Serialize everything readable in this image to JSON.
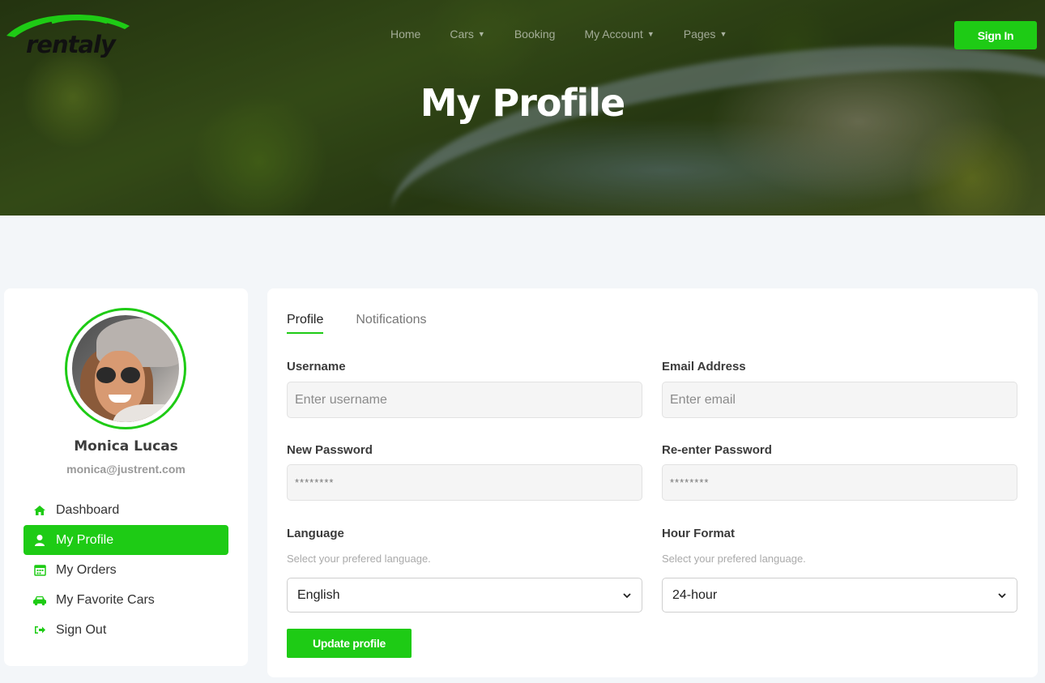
{
  "brand": {
    "logo_text": "rentaly"
  },
  "nav": {
    "items": [
      {
        "label": "Home",
        "has_dropdown": false
      },
      {
        "label": "Cars",
        "has_dropdown": true
      },
      {
        "label": "Booking",
        "has_dropdown": false
      },
      {
        "label": "My Account",
        "has_dropdown": true
      },
      {
        "label": "Pages",
        "has_dropdown": true
      }
    ],
    "signin_label": "Sign In"
  },
  "hero": {
    "title": "My Profile"
  },
  "sidebar": {
    "user_name": "Monica Lucas",
    "user_email": "monica@justrent.com",
    "menu": [
      {
        "label": "Dashboard",
        "icon": "home-icon",
        "active": false
      },
      {
        "label": "My Profile",
        "icon": "user-icon",
        "active": true
      },
      {
        "label": "My Orders",
        "icon": "calendar-icon",
        "active": false
      },
      {
        "label": "My Favorite Cars",
        "icon": "car-icon",
        "active": false
      },
      {
        "label": "Sign Out",
        "icon": "sign-out-icon",
        "active": false
      }
    ]
  },
  "tabs": [
    {
      "label": "Profile",
      "active": true
    },
    {
      "label": "Notifications",
      "active": false
    }
  ],
  "form": {
    "username": {
      "label": "Username",
      "placeholder": "Enter username",
      "value": ""
    },
    "email": {
      "label": "Email Address",
      "placeholder": "Enter email",
      "value": ""
    },
    "new_password": {
      "label": "New Password",
      "placeholder": "********",
      "value": ""
    },
    "reenter_password": {
      "label": "Re-enter Password",
      "placeholder": "********",
      "value": ""
    },
    "language": {
      "label": "Language",
      "help": "Select your prefered language.",
      "value": "English"
    },
    "hour_format": {
      "label": "Hour Format",
      "help": "Select your prefered language.",
      "value": "24-hour"
    },
    "submit_label": "Update profile"
  },
  "colors": {
    "accent": "#1ecb15",
    "page_bg": "#f3f6f9",
    "card_bg": "#ffffff"
  }
}
